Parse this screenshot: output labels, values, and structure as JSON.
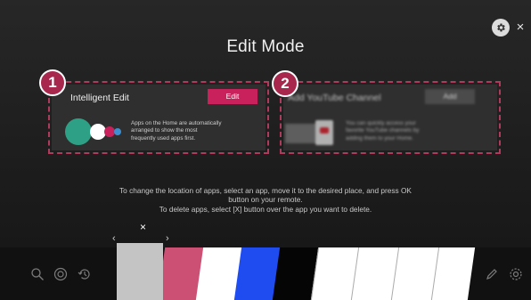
{
  "page": {
    "title": "Edit Mode"
  },
  "top_controls": {
    "settings_icon": "gear-icon",
    "close_label": "×"
  },
  "cards": [
    {
      "badge": "1",
      "title": "Intelligent Edit",
      "button_label": "Edit",
      "description_lines": [
        "Apps on the Home are automatically",
        "arranged to show the most",
        "frequently used apps first."
      ],
      "accent": "#c8215c"
    },
    {
      "badge": "2",
      "title": "Add YouTube Channel",
      "button_label": "Add",
      "description_lines": [
        "You can quickly access your",
        "favorite YouTube channels by",
        "adding them to your Home."
      ],
      "accent": "#555555"
    }
  ],
  "instructions": {
    "line1": "To change the location of apps, select an app, move it to the desired place, and press OK",
    "line2": "button on your remote.",
    "line3": "To delete apps, select [X] button over the app you want to delete."
  },
  "move_controls": {
    "delete_label": "×",
    "left_arrow": "‹",
    "right_arrow": "›"
  },
  "dock": {
    "left_icons": [
      "search-icon",
      "input-icon",
      "recent-icon"
    ],
    "right_icons": [
      "edit-pencil-icon",
      "settings-icon"
    ],
    "tile_colors": [
      "#c4c4c4",
      "#cc4f74",
      "#ffffff",
      "#1f4cf0",
      "#050505",
      "#ffffff",
      "#ffffff",
      "#ffffff",
      "#ffffff"
    ]
  }
}
